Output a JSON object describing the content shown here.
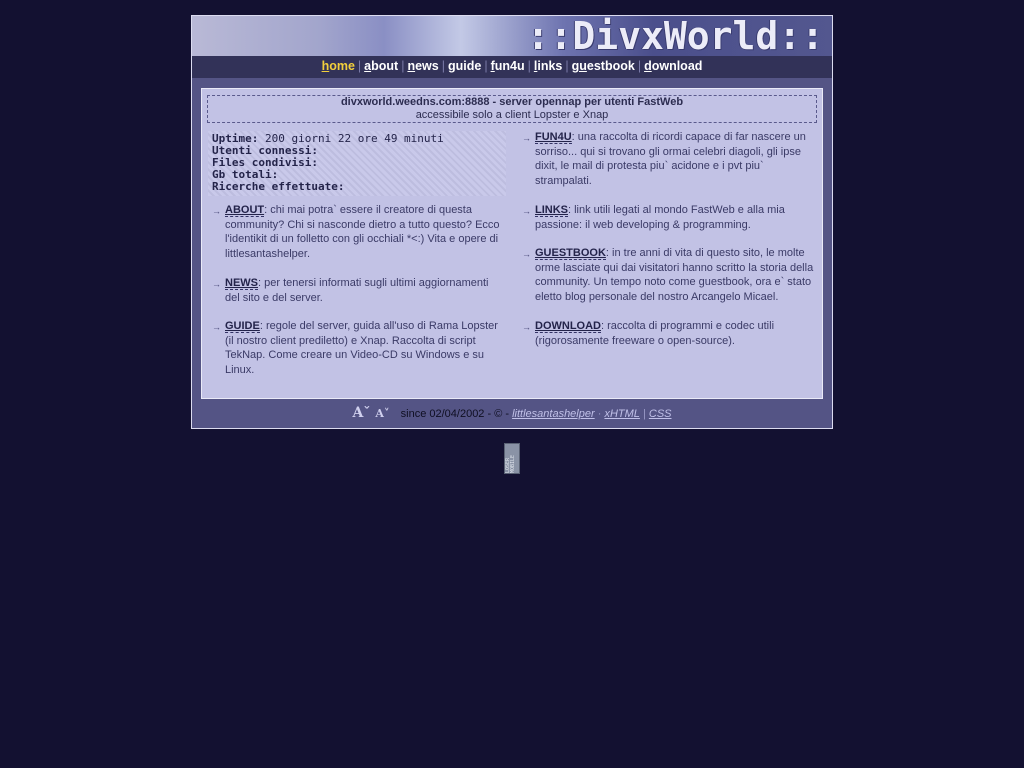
{
  "banner": {
    "logo_text": "::DivxWorld::"
  },
  "nav": {
    "items": [
      {
        "key": "h",
        "rest": "ome"
      },
      {
        "key": "a",
        "rest": "bout"
      },
      {
        "key": "n",
        "rest": "ews"
      },
      {
        "key": "",
        "rest": "guide"
      },
      {
        "key": "f",
        "rest": "un4u"
      },
      {
        "key": "l",
        "rest": "inks"
      },
      {
        "key": "gu",
        "rest": "estbook"
      },
      {
        "key": "d",
        "rest": "ownload"
      }
    ],
    "separator": "|"
  },
  "notice": {
    "title": "divxworld.weedns.com:8888 - server opennap per utenti FastWeb",
    "subtitle": "accessibile solo a client Lopster e Xnap"
  },
  "stats": {
    "uptime_label": "Uptime:",
    "uptime_value": "200 giorni 22 ore 49 minuti",
    "users_label": "Utenti connessi:",
    "files_label": "Files condivisi:",
    "gb_label": "Gb totali:",
    "searches_label": "Ricerche effettuate:"
  },
  "sections": {
    "about": {
      "title": "ABOUT",
      "text": ": chi mai potra` essere il creatore di questa community? Chi si nasconde dietro a tutto questo? Ecco l'identikit di un folletto con gli occhiali *<:) Vita e opere di littlesantashelper."
    },
    "news": {
      "title": "NEWS",
      "text": ": per tenersi informati sugli ultimi aggiornamenti del sito e del server."
    },
    "guide": {
      "title": "GUIDE",
      "text": ": regole del server, guida all'uso di Rama Lopster (il nostro client prediletto) e Xnap. Raccolta di script TekNap. Come creare un Video-CD su Windows e su Linux."
    },
    "fun4u": {
      "title": "FUN4U",
      "text": ": una raccolta di ricordi capace di far nascere un sorriso... qui si trovano gli ormai celebri diagoli, gli ipse dixit, le mail di protesta piu` acidone e i pvt piu` strampalati."
    },
    "links": {
      "title": "LINKS",
      "text": ": link utili legati al mondo FastWeb e alla mia passione: il web developing & programming."
    },
    "guestbook": {
      "title": "GUESTBOOK",
      "text": ": in tre anni di vita di questo sito, le molte orme lasciate qui dai visitatori hanno scritto la storia della community. Un tempo noto come guestbook, ora e` stato eletto blog personale del nostro Arcangelo Micael."
    },
    "download": {
      "title": "DOWNLOAD",
      "text": ": raccolta di programmi e codec utili (rigorosamente freeware o open-source)."
    }
  },
  "footer": {
    "font_up": "A",
    "font_down": "A",
    "since": "since 02/04/2002 - © -",
    "author": "littlesantashelper",
    "xhtml": "xHTML",
    "css": "CSS",
    "sep_dot": "·",
    "sep_bar": "|"
  },
  "badge": {
    "text": "LOSER MOBILE"
  },
  "colors": {
    "background": "#131131",
    "panel": "#545485",
    "content": "#c2c2e5",
    "nav_active": "#f2cf3c"
  }
}
